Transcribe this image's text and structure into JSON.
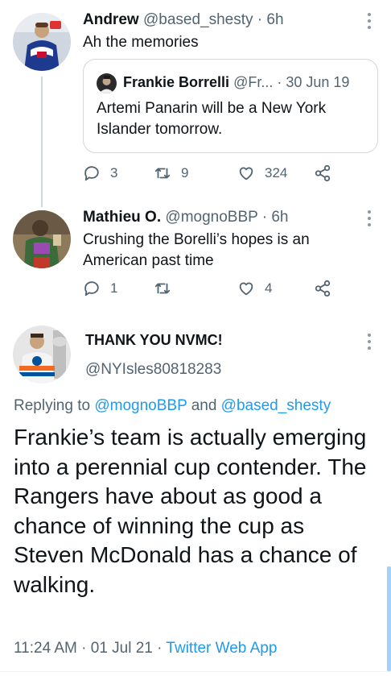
{
  "tweets": [
    {
      "name": "Andrew",
      "handle": "@based_shesty",
      "time": "6h",
      "text": "Ah the memories",
      "quote": {
        "name": "Frankie Borrelli",
        "handle": "@Fr...",
        "date": "30 Jun 19",
        "text": "Artemi Panarin will be a New York Islander tomorrow."
      },
      "actions": {
        "replies": "3",
        "retweets": "9",
        "likes": "324"
      }
    },
    {
      "name": "Mathieu O.",
      "handle": "@mognoBBP",
      "time": "6h",
      "text": "Crushing the Borelli’s hopes is an American past time",
      "actions": {
        "replies": "1",
        "retweets": "",
        "likes": "4"
      }
    }
  ],
  "main_tweet": {
    "name": "THANK YOU NVMC!",
    "handle": "@NYIsles80818283",
    "replying_prefix": "Replying to",
    "replying_user1": "@mognoBBP",
    "replying_and": "and",
    "replying_user2": "@based_shesty",
    "text": "Frankie’s team is actually emerging into a perennial cup contender. The Rangers have about as good a chance of winning the cup as Steven McDonald has a chance of walking.",
    "timestamp": "11:24 AM · 01 Jul 21 ·",
    "app": "Twitter Web App"
  },
  "colors": {
    "link": "#1d9bf0",
    "muted": "#536471",
    "text": "#0f1419",
    "border": "#cfd9de"
  },
  "icons": [
    "reply-icon",
    "retweet-icon",
    "like-icon",
    "share-icon",
    "more-icon"
  ]
}
